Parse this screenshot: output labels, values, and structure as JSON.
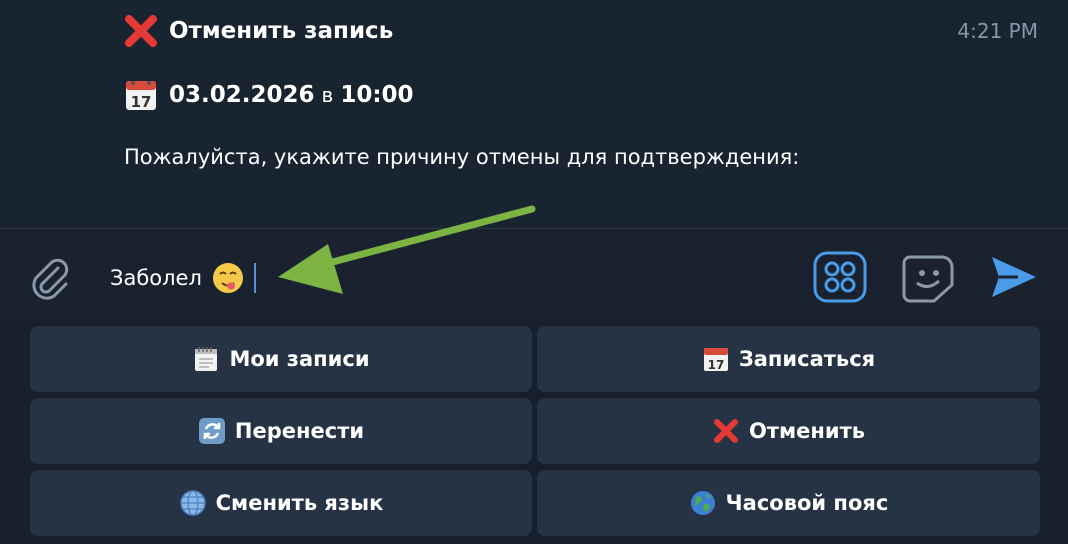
{
  "message": {
    "title": "Отменить запись",
    "date_value": "03.02.2026",
    "date_preposition": "в",
    "time_value": "10:00",
    "body": "Пожалуйста, укажите причину отмены для подтверждения:",
    "timestamp": "4:21 PM"
  },
  "composer": {
    "input_value": "Заболел",
    "emoji": "face-with-tongue-emoji"
  },
  "keyboard": {
    "rows": [
      [
        {
          "label": "Мои записи",
          "icon": "spiral-calendar-icon"
        },
        {
          "label": "Записаться",
          "icon": "calendar-icon"
        }
      ],
      [
        {
          "label": "Перенести",
          "icon": "repeat-arrows-icon"
        },
        {
          "label": "Отменить",
          "icon": "cross-mark-icon"
        }
      ],
      [
        {
          "label": "Сменить язык",
          "icon": "globe-meridians-icon"
        },
        {
          "label": "Часовой пояс",
          "icon": "earth-globe-icon"
        }
      ]
    ]
  },
  "colors": {
    "background": "#16202c",
    "button": "#263344",
    "accent": "#4a9be8",
    "annotation_arrow": "#7cb342"
  }
}
